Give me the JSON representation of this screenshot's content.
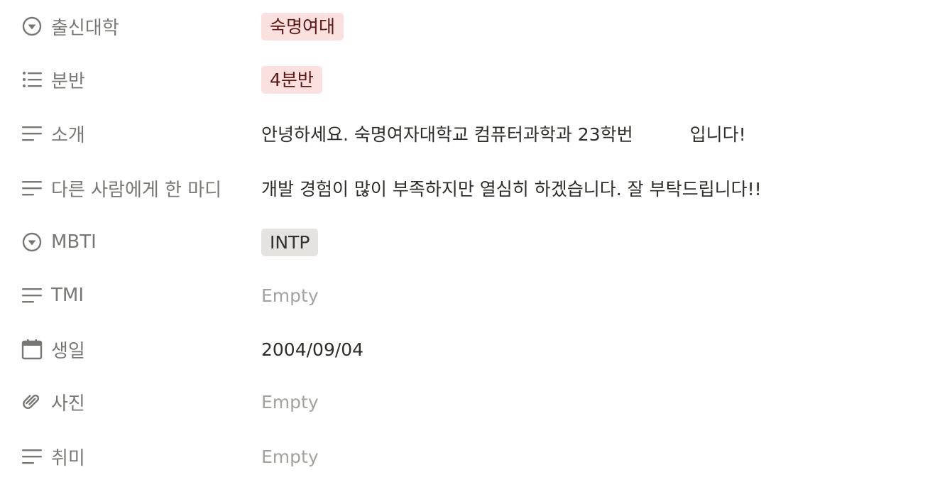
{
  "properties": {
    "university": {
      "label": "출신대학",
      "icon": "select-icon",
      "value": "숙명여대",
      "tag_bg": "#fae0de",
      "tag_fg": "#5d1715"
    },
    "class": {
      "label": "분반",
      "icon": "multi-select-icon",
      "value": "4분반",
      "tag_bg": "#fae0de",
      "tag_fg": "#5d1715"
    },
    "intro": {
      "label": "소개",
      "icon": "text-icon",
      "value_before": "안녕하세요. 숙명여자대학교 컴퓨터과학과 23학번",
      "value_after": "입니다!"
    },
    "message": {
      "label": "다른 사람에게 한 마디",
      "icon": "text-icon",
      "value": "개발 경험이 많이 부족하지만 열심히 하겠습니다. 잘 부탁드립니다!!"
    },
    "mbti": {
      "label": "MBTI",
      "icon": "select-icon",
      "value": "INTP",
      "tag_bg": "#e5e3df",
      "tag_fg": "#32302c"
    },
    "tmi": {
      "label": "TMI",
      "icon": "text-icon",
      "value": "Empty"
    },
    "birthday": {
      "label": "생일",
      "icon": "calendar-icon",
      "value": "2004/09/04"
    },
    "photo": {
      "label": "사진",
      "icon": "paperclip-icon",
      "value": "Empty"
    },
    "hobby": {
      "label": "취미",
      "icon": "text-icon",
      "value": "Empty"
    }
  }
}
